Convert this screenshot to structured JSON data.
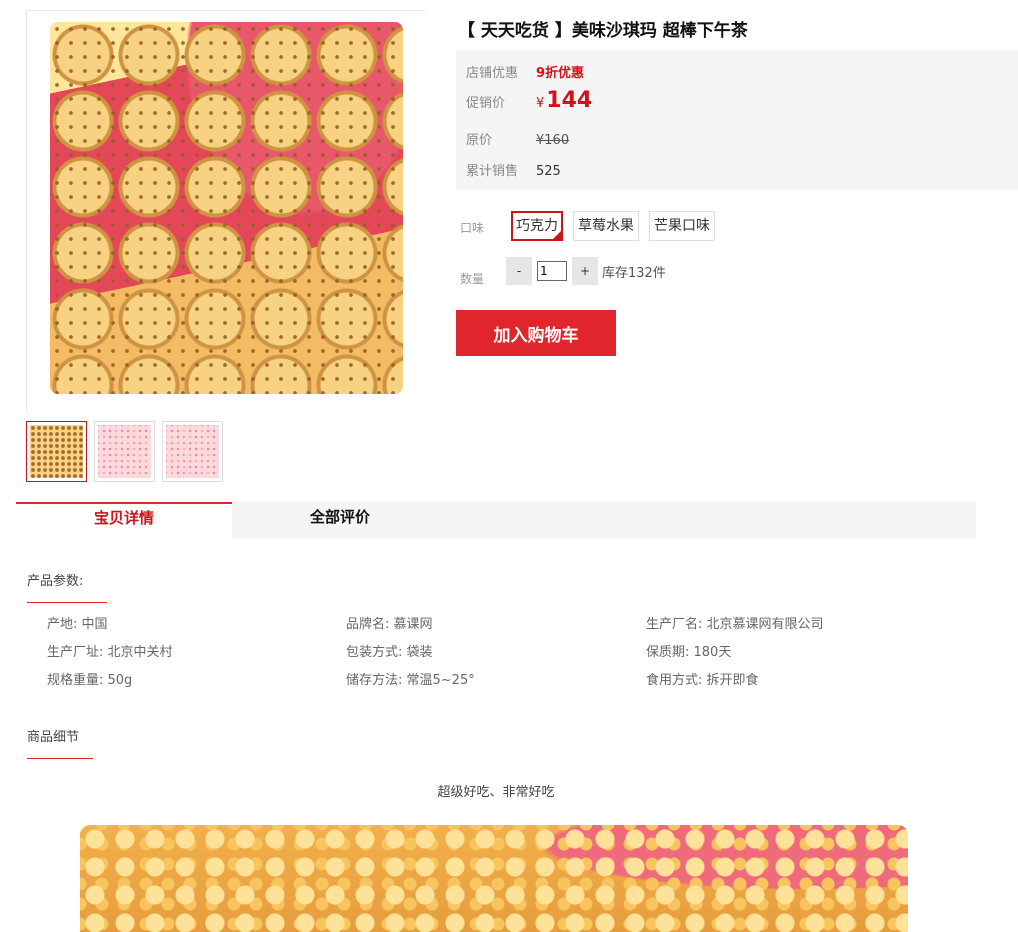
{
  "gallery": {
    "main_image_icon": "snack-photo-icon",
    "thumbnails": [
      "thumb-1",
      "thumb-2",
      "thumb-3"
    ]
  },
  "product": {
    "title": "【 天天吃货 】美味沙琪玛 超棒下午茶",
    "shop_promo_label": "店铺优惠",
    "shop_promo_value": "9折优惠",
    "promo_price_label": "促销价",
    "currency": "¥",
    "promo_price": "144",
    "original_price_label": "原价",
    "original_price": "¥160",
    "sales_label": "累计销售",
    "sales_value": "525",
    "flavor_label": "口味",
    "flavors": [
      "巧克力",
      "草莓水果",
      "芒果口味"
    ],
    "selected_flavor": "巧克力",
    "quantity_label": "数量",
    "quantity_minus": "-",
    "quantity_value": "1",
    "quantity_plus": "+",
    "stock_text": "库存132件",
    "add_to_cart": "加入购物车"
  },
  "tabs": [
    {
      "label": "宝贝详情",
      "active": true
    },
    {
      "label": "全部评价",
      "active": false
    }
  ],
  "details": {
    "params_title": "产品参数:",
    "params": [
      [
        "产地: 中国",
        "品牌名: 慕课网",
        "生产厂名: 北京慕课网有限公司"
      ],
      [
        "生产厂址: 北京中关村",
        "包装方式: 袋装",
        "保质期: 180天"
      ],
      [
        "规格重量: 50g",
        "储存方法: 常温5~25°",
        "食用方式: 拆开即食"
      ]
    ],
    "detail_title": "商品细节",
    "description": "超级好吃、非常好吃"
  },
  "colors": {
    "accent": "#e0262c",
    "price_red": "#d2111a",
    "panel_bg": "#f5f5f5"
  }
}
